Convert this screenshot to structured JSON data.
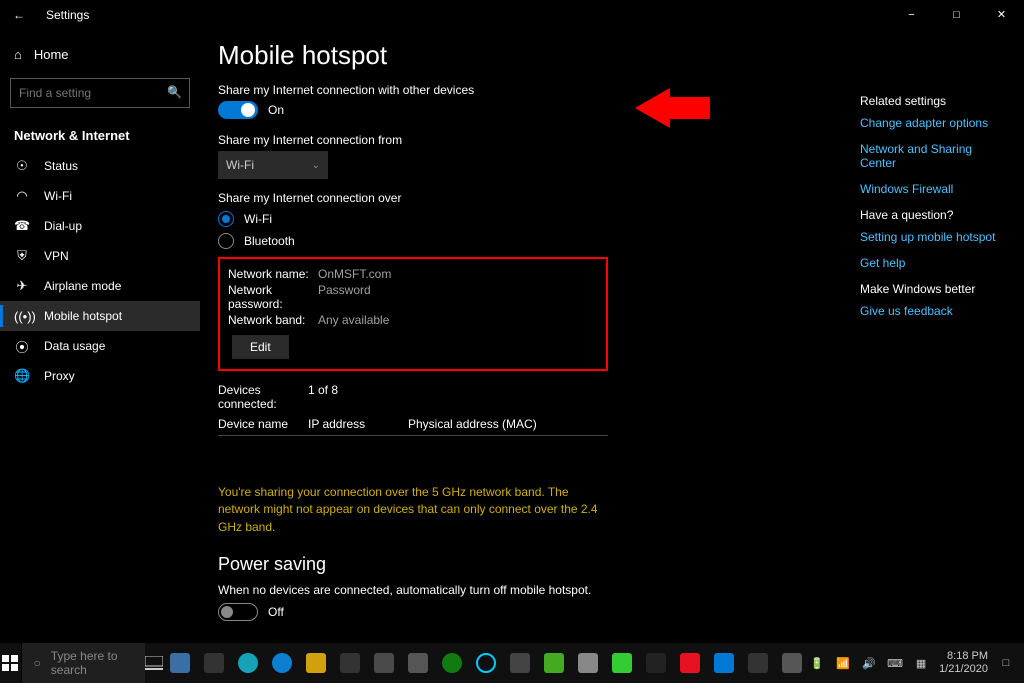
{
  "window": {
    "title": "Settings"
  },
  "sidebar": {
    "home": "Home",
    "search_placeholder": "Find a setting",
    "category": "Network & Internet",
    "items": [
      {
        "icon": "status",
        "label": "Status"
      },
      {
        "icon": "wifi",
        "label": "Wi-Fi"
      },
      {
        "icon": "dialup",
        "label": "Dial-up"
      },
      {
        "icon": "vpn",
        "label": "VPN"
      },
      {
        "icon": "airplane",
        "label": "Airplane mode"
      },
      {
        "icon": "hotspot",
        "label": "Mobile hotspot"
      },
      {
        "icon": "data",
        "label": "Data usage"
      },
      {
        "icon": "proxy",
        "label": "Proxy"
      }
    ]
  },
  "page": {
    "title": "Mobile hotspot",
    "share_label": "Share my Internet connection with other devices",
    "toggle_state": "On",
    "from_label": "Share my Internet connection from",
    "from_value": "Wi-Fi",
    "over_label": "Share my Internet connection over",
    "radios": {
      "wifi": "Wi-Fi",
      "bt": "Bluetooth"
    },
    "network": {
      "name_label": "Network name:",
      "name_value": "OnMSFT.com",
      "pwd_label": "Network password:",
      "pwd_value": "Password",
      "band_label": "Network band:",
      "band_value": "Any available",
      "edit": "Edit"
    },
    "connected": {
      "label": "Devices connected:",
      "value": "1 of 8"
    },
    "table": {
      "c1": "Device name",
      "c2": "IP address",
      "c3": "Physical address (MAC)"
    },
    "warning": "You're sharing your connection over the 5 GHz network band. The network might not appear on devices that can only connect over the 2.4 GHz band.",
    "powersave_title": "Power saving",
    "powersave_desc": "When no devices are connected, automatically turn off mobile hotspot.",
    "powersave_state": "Off"
  },
  "rside": {
    "related": "Related settings",
    "links1": [
      "Change adapter options",
      "Network and Sharing Center",
      "Windows Firewall"
    ],
    "question": "Have a question?",
    "links2": [
      "Setting up mobile hotspot",
      "Get help"
    ],
    "better": "Make Windows better",
    "links3": [
      "Give us feedback"
    ]
  },
  "taskbar": {
    "search_placeholder": "Type here to search",
    "time": "8:18 PM",
    "date": "1/21/2020"
  }
}
